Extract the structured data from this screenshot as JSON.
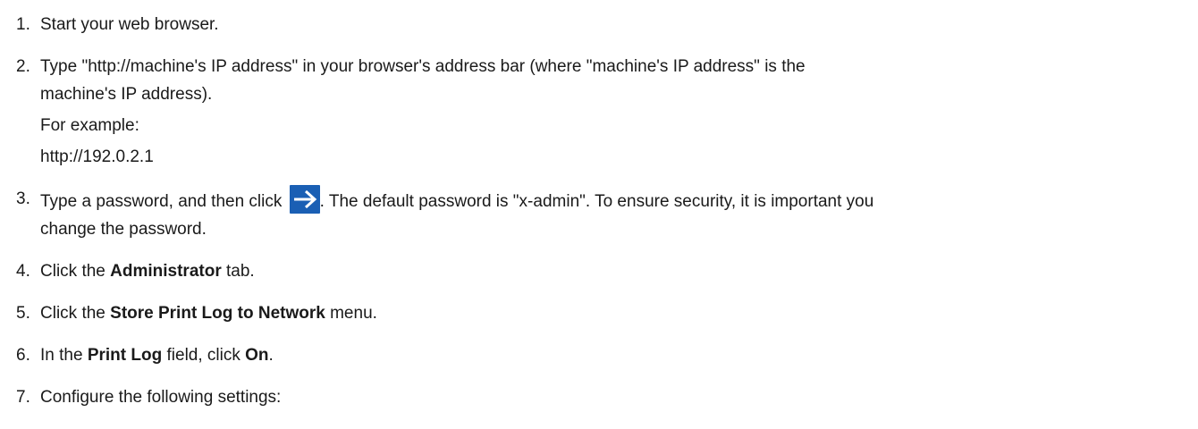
{
  "steps": [
    {
      "number": "1.",
      "text": "Start your web browser."
    },
    {
      "number": "2.",
      "text_line1": "Type \"http://machine's IP address\" in your browser's address bar (where \"machine's IP address\" is the",
      "text_line2": "machine's IP address).",
      "example_label": "For example:",
      "example_value": "http://192.0.2.1"
    },
    {
      "number": "3.",
      "text_before_icon": "Type a password, and then click ",
      "text_after_icon": ". The default password is \"x-admin\". To ensure security, it is important you",
      "text_line2": "change the password.",
      "icon": "arrow-right-icon"
    },
    {
      "number": "4.",
      "pre": "Click the ",
      "bold": "Administrator",
      "post": " tab."
    },
    {
      "number": "5.",
      "pre": "Click the ",
      "bold": "Store Print Log to Network",
      "post": " menu."
    },
    {
      "number": "6.",
      "pre": "In the ",
      "bold1": "Print Log",
      "mid": " field, click ",
      "bold2": "On",
      "post": "."
    },
    {
      "number": "7.",
      "text": "Configure the following settings:"
    }
  ],
  "colors": {
    "text": "#1a1a1a",
    "icon_background": "#1a5fb4",
    "icon_arrow": "#ffffff"
  }
}
